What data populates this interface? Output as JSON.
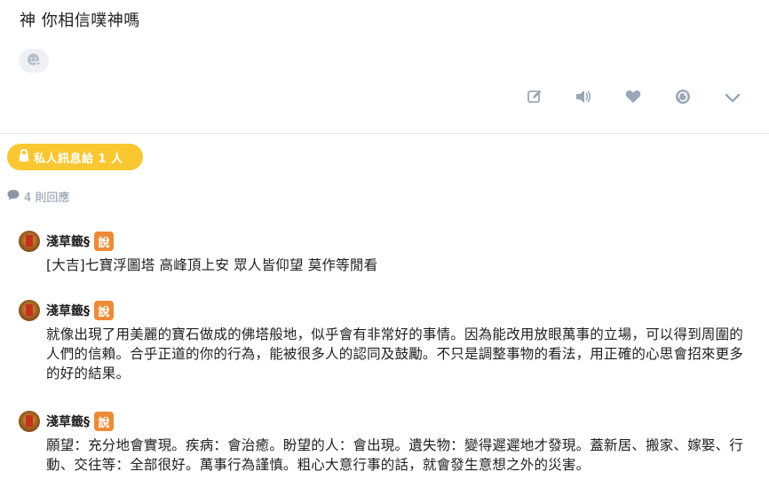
{
  "post": {
    "text": "神 你相信噗神嗎"
  },
  "actions": {
    "icons": [
      "edit-icon",
      "mute-icon",
      "like-icon",
      "replurk-icon",
      "more-icon"
    ]
  },
  "private_badge": {
    "label": "私人訊息給 1 人"
  },
  "replies_count": {
    "label": "4 則回應"
  },
  "replies": [
    {
      "author": "淺草籤§",
      "tag": "說",
      "text": "[大吉]七寶浮圖塔 高峰頂上安 眾人皆仰望 莫作等閒看"
    },
    {
      "author": "淺草籤§",
      "tag": "說",
      "text": "就像出現了用美麗的寶石做成的佛塔般地，似乎會有非常好的事情。因為能改用放眼萬事的立場，可以得到周圍的人們的信賴。合乎正道的你的行為，能被很多人的認同及鼓勵。不只是調整事物的看法，用正確的心思會招來更多的好的結果。"
    },
    {
      "author": "淺草籤§",
      "tag": "說",
      "text": "願望：充分地會實現。疾病：會治癒。盼望的人：會出現。遺失物：變得遲遲地才發現。蓋新居、搬家、嫁娶、行動、交往等：全部很好。萬事行為謹慎。粗心大意行事的話，就會發生意想之外的災害。"
    }
  ],
  "colors": {
    "badge": "#f9c731",
    "tag": "#ee8a35",
    "icon": "#9aa7b5"
  }
}
